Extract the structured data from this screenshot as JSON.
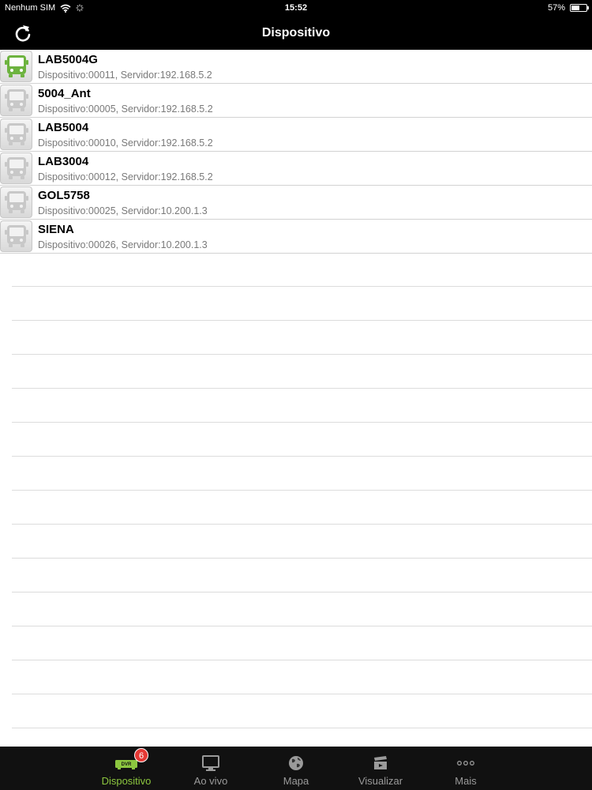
{
  "status_bar": {
    "carrier": "Nenhum SIM",
    "time": "15:52",
    "battery": "57%",
    "battery_level": 0.57
  },
  "nav": {
    "title": "Dispositivo",
    "refresh_icon": "refresh-icon"
  },
  "devices": [
    {
      "name": "LAB5004G",
      "detail": "Dispositivo:00011, Servidor:192.168.5.2",
      "online": true
    },
    {
      "name": "5004_Ant",
      "detail": "Dispositivo:00005, Servidor:192.168.5.2",
      "online": false
    },
    {
      "name": "LAB5004",
      "detail": "Dispositivo:00010, Servidor:192.168.5.2",
      "online": false
    },
    {
      "name": "LAB3004",
      "detail": "Dispositivo:00012, Servidor:192.168.5.2",
      "online": false
    },
    {
      "name": "GOL5758",
      "detail": "Dispositivo:00025, Servidor:10.200.1.3",
      "online": false
    },
    {
      "name": "SIENA",
      "detail": "Dispositivo:00026, Servidor:10.200.1.3",
      "online": false
    }
  ],
  "tabs": [
    {
      "label": "Dispositivo",
      "icon": "dvr-icon",
      "active": true,
      "badge": "6",
      "icon_text": "DVR"
    },
    {
      "label": "Ao vivo",
      "icon": "monitor-icon",
      "active": false
    },
    {
      "label": "Mapa",
      "icon": "globe-icon",
      "active": false
    },
    {
      "label": "Visualizar",
      "icon": "clapper-icon",
      "active": false
    },
    {
      "label": "Mais",
      "icon": "more-icon",
      "active": false
    }
  ],
  "colors": {
    "accent": "#8cc63f",
    "bus_online": "#6db33f",
    "bus_offline": "#c8c8c8",
    "bar": "#000000"
  }
}
